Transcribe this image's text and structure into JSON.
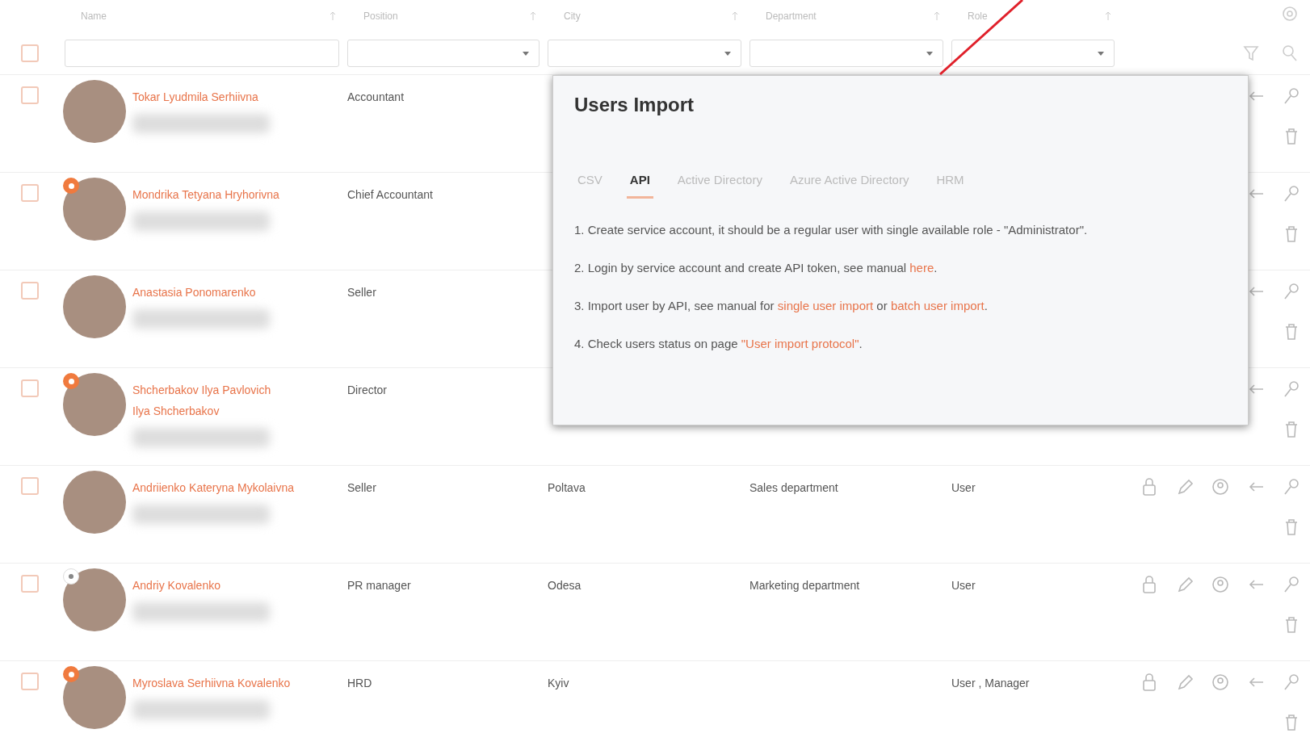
{
  "table": {
    "select_all": {
      "checked": false
    },
    "columns": [
      {
        "label": "Name"
      },
      {
        "label": "Position"
      },
      {
        "label": "City"
      },
      {
        "label": "Department"
      },
      {
        "label": "Role"
      }
    ],
    "filters": [
      {
        "kind": "text"
      },
      {
        "kind": "select"
      },
      {
        "kind": "select"
      },
      {
        "kind": "select"
      },
      {
        "kind": "select"
      }
    ],
    "rows": [
      {
        "checked": false,
        "name": "Tokar Lyudmila Serhiivna",
        "position": "Accountant"
      },
      {
        "checked": false,
        "badge": {
          "kind": "filled"
        },
        "name": "Mondrika Tetyana Hryhorivna",
        "position": "Chief Accountant"
      },
      {
        "checked": false,
        "name": "Anastasia Ponomarenko",
        "position": "Seller"
      },
      {
        "checked": false,
        "badge": {
          "kind": "filled"
        },
        "name": "Shcherbakov Ilya Pavlovich",
        "alias": "Ilya Shcherbakov",
        "position": "Director"
      },
      {
        "checked": false,
        "name": "Andriienko Kateryna Mykolaivna",
        "position": "Seller",
        "city": "Poltava",
        "department": "Sales department",
        "role": "User"
      },
      {
        "checked": false,
        "badge": {
          "kind": "outline"
        },
        "name": "Andriy Kovalenko",
        "position": "PR manager",
        "city": "Odesa",
        "department": "Marketing department",
        "role": "User"
      },
      {
        "checked": false,
        "badge": {
          "kind": "filled"
        },
        "name": "Myroslava Serhiivna Kovalenko",
        "position": "HRD",
        "city": "Kyiv",
        "role": "User , Manager"
      }
    ]
  },
  "dialog": {
    "title": "Users Import",
    "tabs": [
      {
        "label": "CSV",
        "selected": false
      },
      {
        "label": "API",
        "selected": true
      },
      {
        "label": "Active Directory",
        "selected": false
      },
      {
        "label": "Azure Active Directory",
        "selected": false
      },
      {
        "label": "HRM",
        "selected": false
      }
    ],
    "steps": [
      {
        "parts": [
          {
            "kind": "text",
            "text": "1. Create service account, it should be a regular user with single available role - \"Administrator\"."
          }
        ]
      },
      {
        "parts": [
          {
            "kind": "text",
            "text": "2. Login by service account and create API token, see manual "
          },
          {
            "kind": "link",
            "text": "here"
          },
          {
            "kind": "text",
            "text": "."
          }
        ]
      },
      {
        "parts": [
          {
            "kind": "text",
            "text": "3. Import user by API, see manual for "
          },
          {
            "kind": "link",
            "text": "single user import"
          },
          {
            "kind": "text",
            "text": " or "
          },
          {
            "kind": "link",
            "text": "batch user import"
          },
          {
            "kind": "text",
            "text": "."
          }
        ]
      },
      {
        "parts": [
          {
            "kind": "text",
            "text": "4. Check users status on page "
          },
          {
            "kind": "link",
            "text": "\"User import protocol\""
          },
          {
            "kind": "text",
            "text": "."
          }
        ]
      }
    ]
  }
}
